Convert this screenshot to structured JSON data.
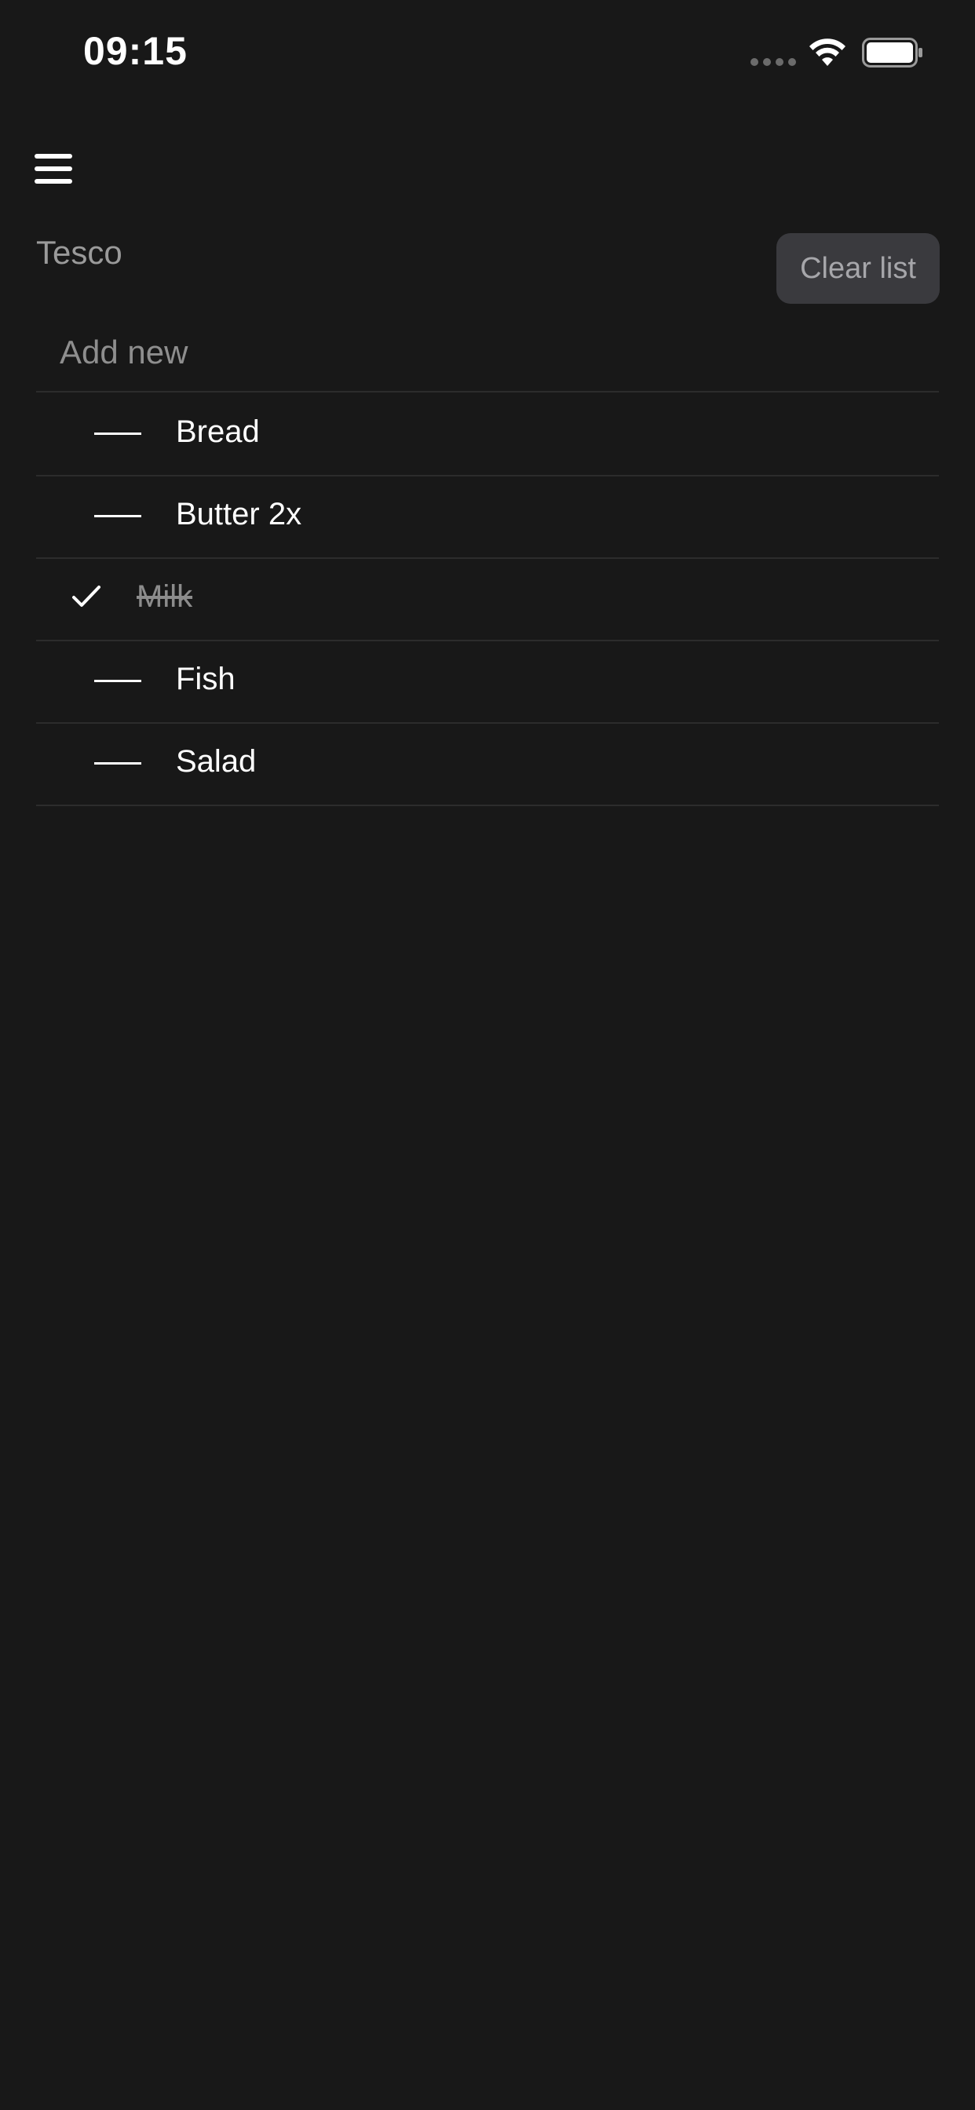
{
  "status_bar": {
    "time": "09:15"
  },
  "header": {
    "list_name": "Tesco",
    "clear_label": "Clear list"
  },
  "add_new": {
    "placeholder": "Add new",
    "value": ""
  },
  "items": [
    {
      "label": "Bread",
      "checked": false
    },
    {
      "label": "Butter 2x",
      "checked": false
    },
    {
      "label": "Milk",
      "checked": true
    },
    {
      "label": "Fish",
      "checked": false
    },
    {
      "label": "Salad",
      "checked": false
    }
  ],
  "icons": {
    "menu": "hamburger-menu-icon",
    "unchecked": "dash-icon",
    "checked": "checkmark-icon",
    "wifi": "wifi-icon",
    "battery": "battery-icon"
  },
  "colors": {
    "background": "#181818",
    "divider": "#2c2c2c",
    "button_bg": "#3a3a3e",
    "muted_text": "#9a9a9a"
  }
}
